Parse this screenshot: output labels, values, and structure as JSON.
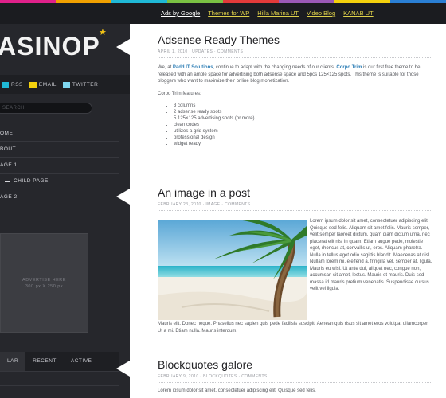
{
  "colors": {
    "rainbow": [
      "#e0218a",
      "#f0a000",
      "#1fb8d6",
      "#7ac143",
      "#e33a3a",
      "#9b59b6",
      "#f4d10d",
      "#2a7fd4"
    ],
    "accent_link": "#2f7fb6",
    "logo_star": "#f3c416"
  },
  "topnav": {
    "links": [
      "Ads by Google",
      "Themes for WP",
      "Hilla Marina UT",
      "Video Blog",
      "KANAB UT"
    ]
  },
  "sidebar": {
    "logo": "ASINOP",
    "logo_star": "★",
    "social": [
      {
        "label": "RSS",
        "color": "#1fb8d6"
      },
      {
        "label": "EMAIL",
        "color": "#f4d10d"
      },
      {
        "label": "TWITTER",
        "color": "#7fd7f0"
      }
    ],
    "search_placeholder": "SEARCH",
    "menu": [
      "OME",
      "BOUT",
      "AGE 1",
      "CHILD PAGE",
      "AGE 2"
    ],
    "ad_line1": "ADVERTISE HERE",
    "ad_line2": "300 px X 250 px",
    "tabs": [
      "LAR",
      "RECENT",
      "ACTIVE"
    ]
  },
  "posts": [
    {
      "title": "Adsense Ready Themes",
      "meta": "APRIL 1, 2010 · UPDATES · COMMENTS",
      "intro_pre": "We, at ",
      "intro_link1": "Padd IT Solutions",
      "intro_mid": ", continue to adapt with the changing needs of our clients. ",
      "intro_link2": "Corpo Trim",
      "intro_post": " is our first free theme to be released with an ample space for advertising both adsense space and 5pcs 125×125 spots. This theme is suitable for those bloggers who want to maximize their online blog monetization.",
      "features_heading": "Corpo Trim features:",
      "features": [
        "3 columns",
        "2 adsense ready spots",
        "5 125×125 advertising spots (or more)",
        "clean codes",
        "utilizes a grid system",
        "professional design",
        "widget ready"
      ]
    },
    {
      "title": "An image in a post",
      "meta": "FEBRUARY 23, 2010 · IMAGE · COMMENTS",
      "side_text": "Lorem ipsum dolor sit amet, consectetuer adipiscing elit. Quisque sed felis. Aliquam sit amet felis. Mauris semper, velit semper laoreet dictum, quam diam dictum urna, nec placerat elit nisl in quam. Etiam augue pede, molestie eget, rhoncus at, convallis ut, eros. Aliquam pharetra. Nulla in tellus eget odio sagittis blandit. Maecenas at nisl. Nullam lorem mi, eleifend a, fringilla vel, semper at, ligula. Mauris eu wisi. Ut ante dui, aliquet nec, congue non, accumsan sit amet, lectus. Mauris et mauris. Duis sed massa id mauris pretium venenatis. Suspendisse cursus velit vel ligula.",
      "bottom_text": "Mauris elit. Donec neque. Phasellus nec sapien quis pede facilisis suscipit. Aenean quis risus sit amet eros volutpat ullamcorper. Ut a mi. Etiam nulla. Mauris interdum."
    },
    {
      "title": "Blockquotes galore",
      "meta": "FEBRUARY 9, 2010 · BLOCKQUOTES · COMMENTS",
      "text": "Lorem ipsum dolor sit amet, consectetuer adipiscing elit. Quisque sed felis."
    }
  ]
}
